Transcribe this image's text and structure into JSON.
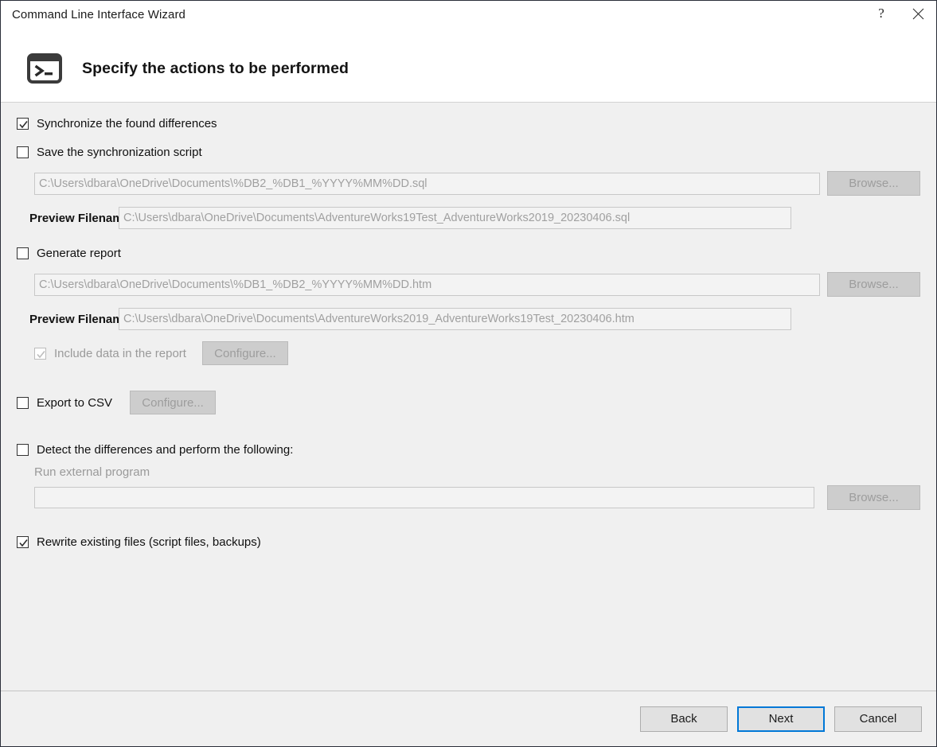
{
  "window": {
    "title": "Command Line Interface Wizard",
    "help_button": "?",
    "close_button": "close-icon"
  },
  "header": {
    "icon": "terminal-icon",
    "title": "Specify the actions to be performed"
  },
  "options": {
    "synchronize": {
      "label": "Synchronize the found differences",
      "checked": true,
      "enabled": true
    },
    "save_script": {
      "label": "Save the synchronization script",
      "checked": false,
      "enabled": true,
      "path_value": "C:\\Users\\dbara\\OneDrive\\Documents\\%DB2_%DB1_%YYYY%MM%DD.sql",
      "browse_label": "Browse...",
      "browse_enabled": false,
      "preview_label": "Preview Filename",
      "preview_value": "C:\\Users\\dbara\\OneDrive\\Documents\\AdventureWorks19Test_AdventureWorks2019_20230406.sql"
    },
    "generate_report": {
      "label": "Generate report",
      "checked": false,
      "enabled": true,
      "path_value": "C:\\Users\\dbara\\OneDrive\\Documents\\%DB1_%DB2_%YYYY%MM%DD.htm",
      "browse_label": "Browse...",
      "browse_enabled": false,
      "preview_label": "Preview Filename",
      "preview_value": "C:\\Users\\dbara\\OneDrive\\Documents\\AdventureWorks2019_AdventureWorks19Test_20230406.htm",
      "include_data": {
        "label": "Include data in the report",
        "checked": true,
        "enabled": false
      },
      "configure_label": "Configure...",
      "configure_enabled": false
    },
    "export_csv": {
      "label": "Export to CSV",
      "checked": false,
      "enabled": true,
      "configure_label": "Configure...",
      "configure_enabled": false
    },
    "detect_differences": {
      "label": "Detect the differences and perform the following:",
      "checked": false,
      "enabled": true,
      "run_external_label": "Run external program",
      "run_external_value": "",
      "browse_label": "Browse...",
      "browse_enabled": false
    },
    "rewrite_files": {
      "label": "Rewrite existing files (script files, backups)",
      "checked": true,
      "enabled": true
    }
  },
  "footer": {
    "back_label": "Back",
    "next_label": "Next",
    "cancel_label": "Cancel"
  },
  "colors": {
    "accent": "#0078d7",
    "body_background": "#f0f0f0",
    "titlebar_background": "#ffffff",
    "field_text": "#a0a0a0",
    "disabled_text": "#9a9a9a"
  }
}
